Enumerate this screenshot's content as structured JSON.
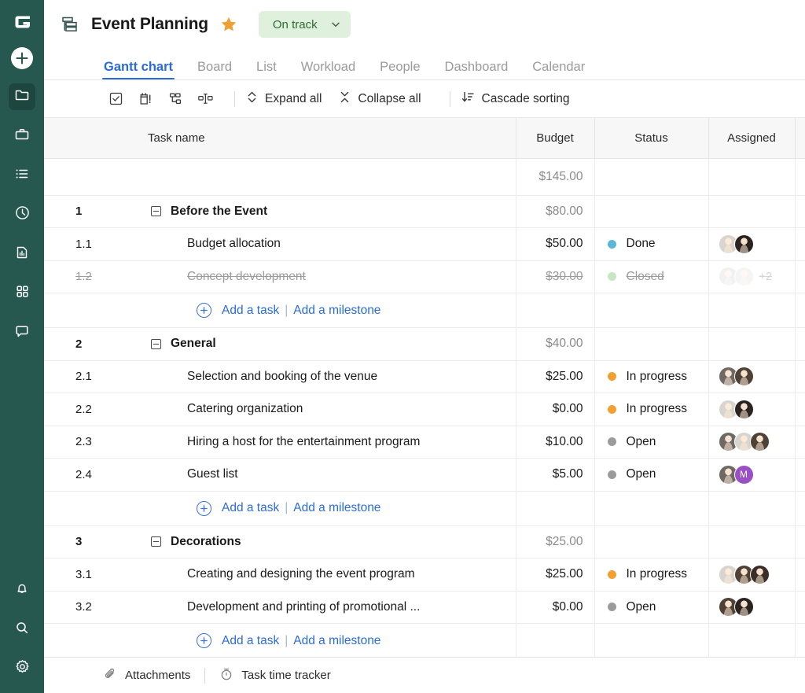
{
  "brand": {
    "logo_letter": "G",
    "rail_bg": "#275850",
    "accent": "#2b6cd4"
  },
  "rail": {
    "add_label": "add-new",
    "items": [
      {
        "icon": "folder-icon",
        "label": "Projects",
        "active": true
      },
      {
        "icon": "briefcase-icon",
        "label": "Portfolios",
        "active": false
      },
      {
        "icon": "list-icon",
        "label": "Tasks",
        "active": false
      },
      {
        "icon": "clock-icon",
        "label": "Time log",
        "active": false
      },
      {
        "icon": "report-icon",
        "label": "Reports",
        "active": false
      },
      {
        "icon": "grid-icon",
        "label": "Apps",
        "active": false
      },
      {
        "icon": "chat-icon",
        "label": "Chat",
        "active": false
      }
    ],
    "bottom_items": [
      {
        "icon": "bell-icon",
        "label": "Notifications"
      },
      {
        "icon": "search-icon",
        "label": "Search"
      },
      {
        "icon": "gear-icon",
        "label": "Settings"
      }
    ]
  },
  "header": {
    "project_icon": "gantt-project-icon",
    "title": "Event Planning",
    "favorite_icon": "star-icon",
    "status": {
      "label": "On track",
      "bg": "#dff0dc",
      "color": "#2f6b33",
      "chevron": "chevron-down-icon"
    }
  },
  "tabs": [
    {
      "label": "Gantt chart",
      "active": true
    },
    {
      "label": "Board",
      "active": false
    },
    {
      "label": "List",
      "active": false
    },
    {
      "label": "Workload",
      "active": false
    },
    {
      "label": "People",
      "active": false
    },
    {
      "label": "Dashboard",
      "active": false
    },
    {
      "label": "Calendar",
      "active": false
    }
  ],
  "toolbar": {
    "icons": [
      {
        "name": "checkbox-tasks-icon"
      },
      {
        "name": "critical-path-icon"
      },
      {
        "name": "dependencies-icon"
      },
      {
        "name": "baseline-icon"
      }
    ],
    "actions": [
      {
        "label": "Expand all",
        "icon": "expand-all-icon"
      },
      {
        "label": "Collapse all",
        "icon": "collapse-all-icon"
      },
      {
        "label": "Cascade sorting",
        "icon": "cascade-sorting-icon"
      }
    ]
  },
  "table": {
    "columns": {
      "num": "",
      "name": "Task name",
      "budget": "Budget",
      "status": "Status",
      "assigned": "Assigned",
      "add": "add-column-icon"
    },
    "row_menu": "···",
    "add_task_label": "Add a task",
    "add_milestone_label": "Add a milestone",
    "add_separator": "|",
    "summary": {
      "budget": "$145.00"
    },
    "rows": [
      {
        "kind": "group",
        "num": "1",
        "name": "Before the Event",
        "budget": "$80.00",
        "status": "",
        "status_color": "",
        "avatars": [],
        "extra": ""
      },
      {
        "kind": "task",
        "num": "1.1",
        "name": "Budget allocation",
        "budget": "$50.00",
        "status": "Done",
        "status_color": "#5bb7d8",
        "avatars": [
          "#d8d4d0",
          "#2a2320"
        ],
        "extra": ""
      },
      {
        "kind": "task",
        "num": "1.2",
        "name": "Concept development",
        "budget": "$30.00",
        "status": "Closed",
        "status_color": "#c8e6c4",
        "avatars": [
          "#cfcfcf",
          "#dcdcdc"
        ],
        "extra": "+2",
        "dimmed": true
      },
      {
        "kind": "add",
        "num": "",
        "name": "",
        "budget": "",
        "status": "",
        "avatars": []
      },
      {
        "kind": "group",
        "num": "2",
        "name": "General",
        "budget": "$40.00",
        "status": "",
        "status_color": "",
        "avatars": [],
        "extra": ""
      },
      {
        "kind": "task",
        "num": "2.1",
        "name": "Selection and booking of the venue",
        "budget": "$25.00",
        "status": "In progress",
        "status_color": "#f2a032",
        "avatars": [
          "#6e6a63",
          "#4e4136"
        ],
        "extra": ""
      },
      {
        "kind": "task",
        "num": "2.2",
        "name": "Catering organization",
        "budget": "$0.00",
        "status": "In progress",
        "status_color": "#f2a032",
        "avatars": [
          "#d8d4d0",
          "#2a2320"
        ],
        "extra": ""
      },
      {
        "kind": "task",
        "num": "2.3",
        "name": "Hiring a host for the entertainment program",
        "budget": "$10.00",
        "status": "Open",
        "status_color": "#9b9b9b",
        "avatars": [
          "#6e6a63",
          "#d8d4d0",
          "#4e4136"
        ],
        "extra": ""
      },
      {
        "kind": "task",
        "num": "2.4",
        "name": "Guest list",
        "budget": "$5.00",
        "status": "Open",
        "status_color": "#9b9b9b",
        "avatars": [
          "#6e6a63",
          "#9b4fc4"
        ],
        "avatar_letters": [
          "",
          "M"
        ],
        "extra": ""
      },
      {
        "kind": "add",
        "num": "",
        "name": "",
        "budget": "",
        "status": "",
        "avatars": []
      },
      {
        "kind": "group",
        "num": "3",
        "name": "Decorations",
        "budget": "$25.00",
        "status": "",
        "status_color": "",
        "avatars": [],
        "extra": ""
      },
      {
        "kind": "task",
        "num": "3.1",
        "name": "Creating and designing the event program",
        "budget": "$25.00",
        "status": "In progress",
        "status_color": "#f2a032",
        "avatars": [
          "#d8d4d0",
          "#4e4136",
          "#3a2e26"
        ],
        "extra": ""
      },
      {
        "kind": "task",
        "num": "3.2",
        "name": "Development and printing of promotional ...",
        "budget": "$0.00",
        "status": "Open",
        "status_color": "#9b9b9b",
        "avatars": [
          "#4e4136",
          "#2a2320"
        ],
        "extra": ""
      },
      {
        "kind": "add",
        "num": "",
        "name": "",
        "budget": "",
        "status": "",
        "avatars": []
      }
    ]
  },
  "bottombar": {
    "items": [
      {
        "label": "Attachments",
        "icon": "paperclip-icon"
      },
      {
        "label": "Task time tracker",
        "icon": "stopwatch-icon"
      }
    ],
    "separator": "|"
  }
}
